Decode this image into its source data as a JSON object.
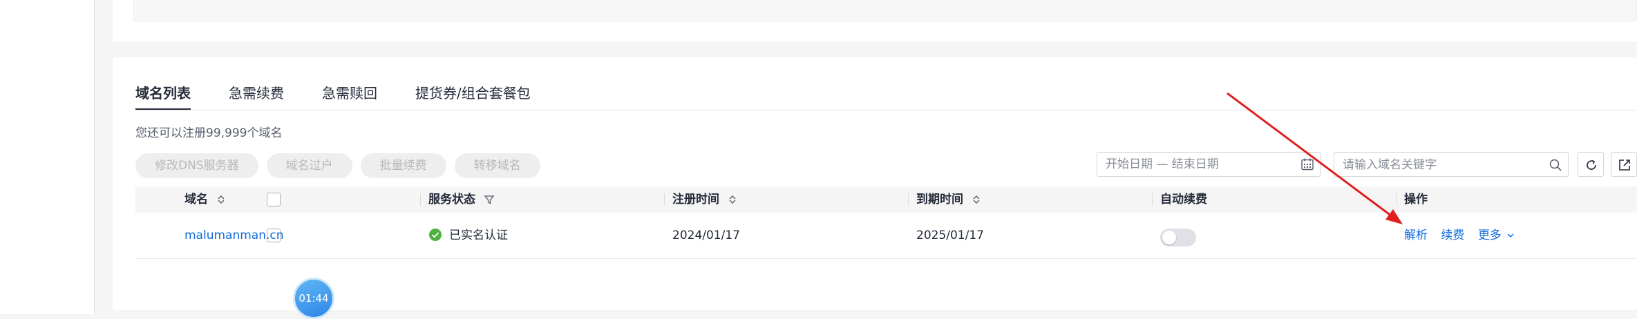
{
  "tabs": [
    {
      "label": "域名列表",
      "active": true
    },
    {
      "label": "急需续费",
      "active": false
    },
    {
      "label": "急需赎回",
      "active": false
    },
    {
      "label": "提货券/组合套餐包",
      "active": false
    }
  ],
  "quota_text": "您还可以注册99,999个域名",
  "actions": {
    "modify_dns": "修改DNS服务器",
    "transfer_out": "域名过户",
    "batch_renew": "批量续费",
    "transfer_domain": "转移域名"
  },
  "date_range": {
    "placeholder": "开始日期 — 结束日期",
    "icon": "calendar-icon"
  },
  "search": {
    "placeholder": "请输入域名关键字",
    "icon": "search-icon"
  },
  "toolbar_icons": {
    "refresh": "refresh-icon",
    "export": "export-icon"
  },
  "table": {
    "headers": {
      "domain": "域名",
      "status": "服务状态",
      "reg_time": "注册时间",
      "expire_time": "到期时间",
      "auto_renew": "自动续费",
      "operations": "操作"
    },
    "rows": [
      {
        "domain": "malumanman.cn",
        "status": "已实名认证",
        "reg_time": "2024/01/17",
        "expire_time": "2025/01/17",
        "auto_renew": false,
        "ops": {
          "resolve": "解析",
          "renew": "续费",
          "more": "更多"
        }
      }
    ]
  },
  "timer": "01:44",
  "colors": {
    "link": "#0e6bdc",
    "success": "#50b041",
    "annotation_arrow": "#e02020"
  }
}
